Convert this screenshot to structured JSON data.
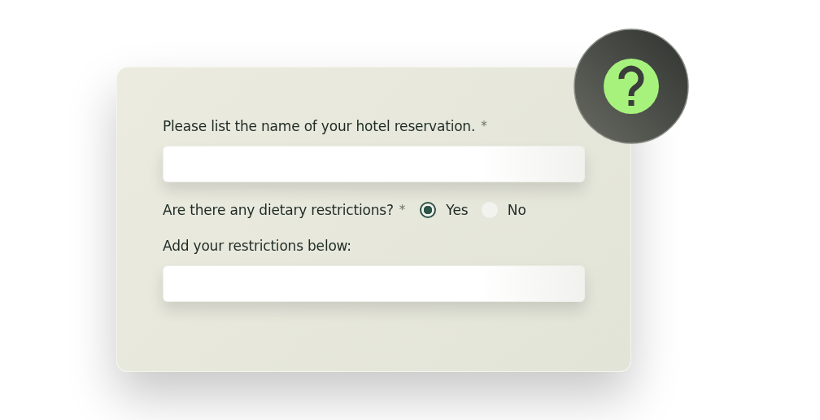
{
  "form": {
    "questions": [
      {
        "kind": "text",
        "label": "Please list the name of your hotel reservation.",
        "required_mark": "*"
      },
      {
        "kind": "radio",
        "label": "Are there any dietary restrictions?",
        "required_mark": "*",
        "options": [
          {
            "label": "Yes",
            "selected": true
          },
          {
            "label": "No",
            "selected": false
          }
        ]
      },
      {
        "kind": "text",
        "label": "Add your restrictions below:"
      }
    ]
  }
}
